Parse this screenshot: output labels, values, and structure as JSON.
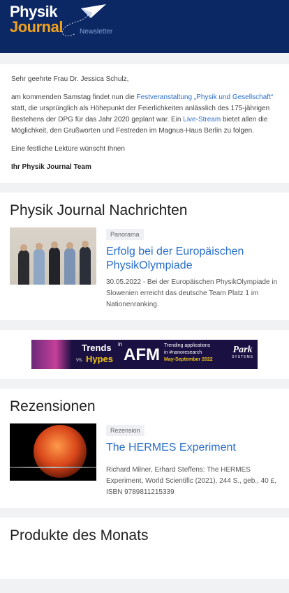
{
  "header": {
    "logo_line1": "Physik",
    "logo_line2": "Journal",
    "logo_sub": "Newsletter",
    "plane_icon": "paper-plane-icon"
  },
  "intro": {
    "greeting": "Sehr geehrte Frau Dr. Jessica Schulz,",
    "p1_a": "am kommenden Samstag findet nun die ",
    "p1_link1": "Festveranstaltung „Physik und Gesellschaft“",
    "p1_b": " statt, die ursprünglich als Höhepunkt der Feierlichkeiten anlässlich des 175-jährigen Bestehens der DPG für das Jahr 2020 geplant war. Ein ",
    "p1_link2": "Live-Stream",
    "p1_c": " bietet allen die Möglichkeit, den Grußworten und Festreden im Magnus-Haus Berlin zu folgen.",
    "closing": "Eine festliche Lektüre wünscht Ihnen",
    "signature": "Ihr Physik Journal Team"
  },
  "news": {
    "heading": "Physik Journal Nachrichten",
    "tag": "Panorama",
    "title": "Erfolg bei der Europäischen PhysikOlympiade",
    "text": "30.05.2022 - Bei der Europäischen PhysikOlympiade in Slowenien erreicht das deutsche Team Platz 1 im Nationenranking."
  },
  "banner": {
    "trends": "Trends",
    "in": "in",
    "vs": "vs.",
    "hypes": "Hypes",
    "afm": "AFM",
    "right_line1": "Trending applications",
    "right_line2": "in #nanoresearch",
    "right_line3": "May-September 2022",
    "brand": "Park",
    "brand_sub": "SYSTEMS"
  },
  "reviews": {
    "heading": "Rezensionen",
    "tag": "Rezension",
    "title": "The HERMES Experiment",
    "text": "Richard Milner, Erhard Steffens: The HERMES Experiment, World Scientific (2021), 244 S., geb., 40 £, ISBN 9789811215339"
  },
  "products": {
    "heading": "Produkte des Monats"
  },
  "colors": {
    "header_bg": "#0c2864",
    "accent": "#f0a21c",
    "link": "#2a6fc9"
  }
}
